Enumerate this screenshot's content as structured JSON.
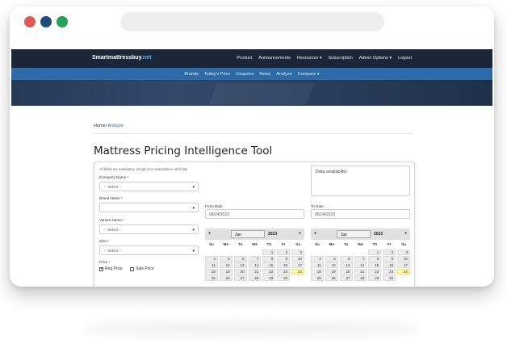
{
  "site": {
    "logo_main": "Smartmattressbuy",
    "logo_tld": ".net",
    "top_menu": [
      "Product",
      "Announcements",
      "Resources ▾",
      "Subscription",
      "Admin Options ▾",
      "Logout"
    ],
    "sub_menu": [
      "Brands",
      "Today's Price",
      "Coupons",
      "News",
      "Analyze",
      "Compare ▾"
    ]
  },
  "breadcrumb": {
    "home": "Home",
    "sep": "/",
    "current": "Analyze"
  },
  "page_title": "Mattress Pricing Intelligence Tool",
  "form": {
    "note": "All fields are mandatory. (single item selectable in all fields)",
    "company_label": "Company Name *",
    "company_value": "-- Select --",
    "brand_label": "Brand Name *",
    "brand_value": "",
    "variant_label": "Variant Name *",
    "variant_value": "-- Select --",
    "size_label": "Size *",
    "size_value": "-- Select --",
    "price_label": "Price *",
    "reg_price": "Reg Price",
    "sale_price": "Sale Price",
    "reg_checked": "✔",
    "sale_checked": ""
  },
  "availability_label": "Data availability",
  "from": {
    "label": "From Date",
    "value": "06/24/2023",
    "month": "Jun",
    "year": "2023"
  },
  "to": {
    "label": "To Date",
    "value": "06/24/2023",
    "month": "Jun",
    "year": "2023"
  },
  "calendar": {
    "dow": [
      "Su",
      "Mo",
      "Tu",
      "We",
      "Th",
      "Fr",
      "Sa"
    ],
    "weeks": [
      [
        "",
        "",
        "",
        "",
        "1",
        "2",
        "3"
      ],
      [
        "4",
        "5",
        "6",
        "7",
        "8",
        "9",
        "10"
      ],
      [
        "11",
        "12",
        "13",
        "14",
        "15",
        "16",
        "17"
      ],
      [
        "18",
        "19",
        "20",
        "21",
        "22",
        "23",
        "24"
      ],
      [
        "25",
        "26",
        "27",
        "28",
        "29",
        "30",
        ""
      ]
    ],
    "highlight": "24"
  }
}
